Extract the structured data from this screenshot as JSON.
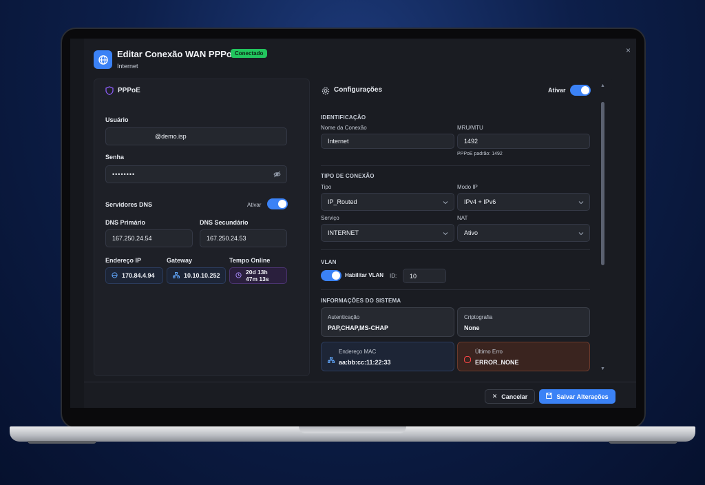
{
  "dialog": {
    "title": "Editar Conexão WAN PPPoE",
    "status_badge": "Conectado",
    "subtitle": "Internet",
    "close_label": "×"
  },
  "left": {
    "heading": "PPPoE",
    "user_label": "Usuário",
    "user_value": "@demo.isp",
    "password_label": "Senha",
    "password_value": "••••••••",
    "dns_section": "Servidores DNS",
    "dns_toggle_label": "Ativar",
    "dns_primary_label": "DNS Primário",
    "dns_primary_value": "167.250.24.54",
    "dns_secondary_label": "DNS Secundário",
    "dns_secondary_value": "167.250.24.53",
    "ip_label": "Endereço IP",
    "ip_value": "170.84.4.94",
    "gateway_label": "Gateway",
    "gateway_value": "10.10.10.252",
    "uptime_label": "Tempo Online",
    "uptime_line1": "20d 13h",
    "uptime_line2": "47m 13s"
  },
  "right": {
    "heading": "Configurações",
    "active_label": "Ativar",
    "ident_section": "IDENTIFICAÇÃO",
    "name_label": "Nome da Conexão",
    "name_value": "Internet",
    "mtu_label": "MRU/MTU",
    "mtu_value": "1492",
    "mtu_hint": "PPPoE padrão: 1492",
    "conn_section": "TIPO DE CONEXÃO",
    "type_label": "Tipo",
    "type_value": "IP_Routed",
    "ipmode_label": "Modo IP",
    "ipmode_value": "IPv4 + IPv6",
    "service_label": "Serviço",
    "service_value": "INTERNET",
    "nat_label": "NAT",
    "nat_value": "Ativo",
    "vlan_section": "VLAN",
    "vlan_toggle_label": "Habilitar VLAN",
    "vlan_id_label": "ID:",
    "vlan_id_value": "10",
    "sys_section": "INFORMAÇÕES DO SISTEMA",
    "auth_label": "Autenticação",
    "auth_value": "PAP,CHAP,MS-CHAP",
    "crypto_label": "Criptografia",
    "crypto_value": "None",
    "mac_label": "Endereço MAC",
    "mac_value": "aa:bb:cc:11:22:33",
    "error_label": "Último Erro",
    "error_value": "ERROR_NONE"
  },
  "footer": {
    "cancel_label": "Cancelar",
    "save_label": "Salvar Alterações"
  },
  "colors": {
    "accent": "#3b82f6",
    "success": "#22c55e",
    "purple": "#8b5cf6",
    "error": "#ef4444"
  }
}
